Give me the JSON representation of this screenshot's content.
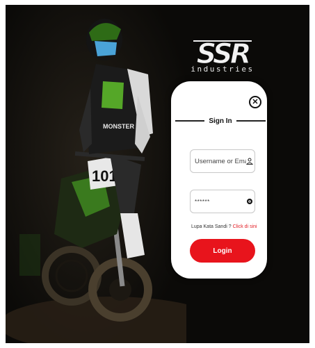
{
  "brand": {
    "logo_mark": "SSR",
    "logo_subtitle": "industries"
  },
  "signin": {
    "title": "Sign In",
    "username_placeholder": "Username or Email",
    "password_value": "******",
    "forgot_text": "Lupa Kata Sandi ?",
    "forgot_link": "Click di sini",
    "login_label": "Login"
  },
  "background": {
    "bike_number": "101"
  },
  "colors": {
    "accent": "#e8141c",
    "monster_green": "#5fbf2a",
    "background": "#0b0a08"
  },
  "icons": {
    "close": "close-icon",
    "user": "user-icon",
    "password": "eye-icon"
  }
}
